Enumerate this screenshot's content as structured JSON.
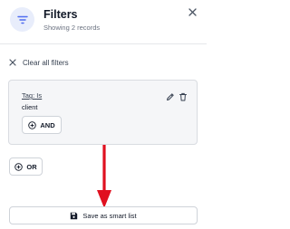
{
  "header": {
    "title": "Filters",
    "subtitle": "Showing 2 records",
    "filter_icon": "filter-lines-icon",
    "close_icon": "close-icon",
    "badge_color": "#e8edfb",
    "accent_color": "#4f6df0"
  },
  "clear_all": {
    "icon": "close-icon",
    "label": "Clear all filters"
  },
  "filter_group": {
    "condition": {
      "field": "Tag:",
      "operator": "Is",
      "value": "client",
      "edit_icon": "pencil-icon",
      "delete_icon": "trash-icon"
    },
    "and_button": {
      "label": "AND",
      "icon": "plus-circle-icon"
    }
  },
  "or_button": {
    "label": "OR",
    "icon": "plus-circle-icon"
  },
  "save_button": {
    "label": "Save as smart list",
    "icon": "floppy-disk-icon"
  },
  "annotation": {
    "arrow_color": "#e0101f"
  }
}
